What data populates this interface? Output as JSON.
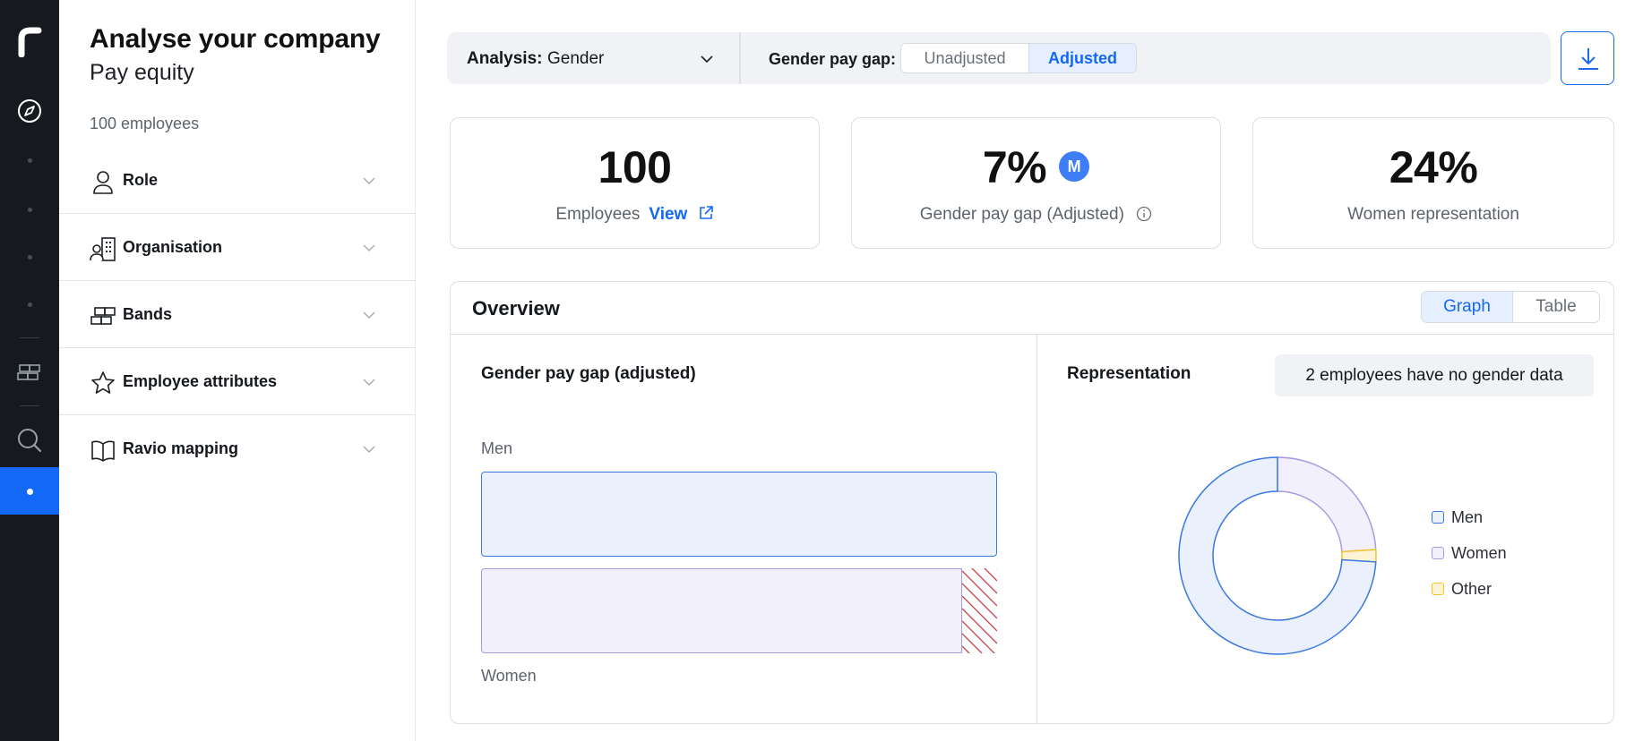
{
  "rail": {
    "logo": "r",
    "active_index": 5
  },
  "panel": {
    "title": "Analyse your company",
    "subtitle": "Pay equity",
    "employee_count": "100 employees",
    "filters": [
      {
        "label": "Role",
        "icon": "person-icon"
      },
      {
        "label": "Organisation",
        "icon": "org-building-icon"
      },
      {
        "label": "Bands",
        "icon": "bands-icon"
      },
      {
        "label": "Employee attributes",
        "icon": "star-icon"
      },
      {
        "label": "Ravio mapping",
        "icon": "book-icon"
      }
    ]
  },
  "topbar": {
    "analysis_label": "Analysis:",
    "analysis_value": "Gender",
    "gap_label": "Gender pay gap:",
    "gap_options": [
      "Unadjusted",
      "Adjusted"
    ],
    "gap_selected": "Adjusted"
  },
  "kpis": {
    "employees": {
      "value": "100",
      "label": "Employees",
      "link": "View"
    },
    "gap": {
      "value": "7%",
      "badge": "M",
      "label": "Gender pay gap (Adjusted)"
    },
    "women": {
      "value": "24%",
      "label": "Women representation"
    }
  },
  "overview": {
    "title": "Overview",
    "view_options": [
      "Graph",
      "Table"
    ],
    "view_selected": "Graph",
    "gap_chart": {
      "title": "Gender pay gap (adjusted)",
      "men_label": "Men",
      "women_label": "Women",
      "women_relative_pay": 0.93
    },
    "representation": {
      "title": "Representation",
      "notice": "2 employees have no gender data"
    }
  },
  "chart_data": [
    {
      "type": "bar",
      "title": "Gender pay gap (adjusted)",
      "categories": [
        "Men",
        "Women"
      ],
      "values": [
        100,
        93
      ],
      "gap_percent": 7,
      "orientation": "horizontal"
    },
    {
      "type": "pie",
      "title": "Representation",
      "labels": [
        "Men",
        "Women",
        "Other"
      ],
      "values": [
        74,
        24,
        2
      ],
      "colors": {
        "Men": "#3b78e0",
        "Women": "#a99ae0",
        "Other": "#f0c430"
      },
      "legend": "right"
    }
  ],
  "colors": {
    "accent": "#1468f2",
    "rail_bg": "#16191d",
    "men_fill": "#eaf1fd",
    "women_fill": "#f2f0fc",
    "hatch": "#c8404a"
  }
}
